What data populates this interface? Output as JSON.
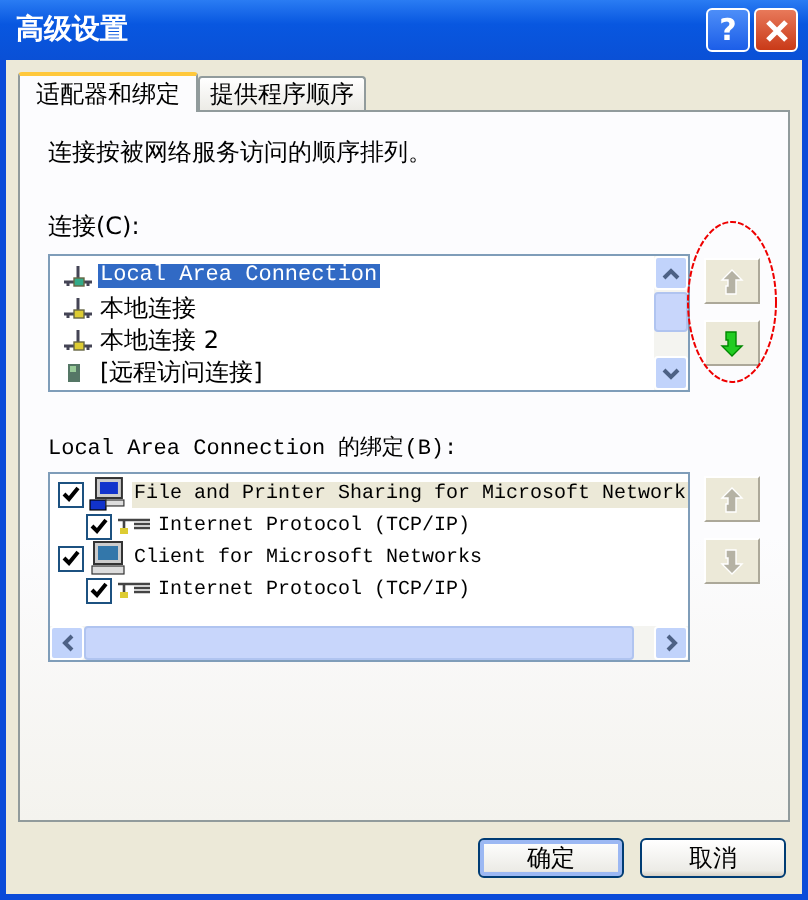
{
  "window": {
    "title": "高级设置",
    "help": "?"
  },
  "tabs": [
    {
      "label": "适配器和绑定",
      "selected": true
    },
    {
      "label": "提供程序顺序",
      "selected": false
    }
  ],
  "description": "连接按被网络服务访问的顺序排列。",
  "connections_label": "连接(C):",
  "connections": [
    {
      "name": "Local Area Connection",
      "kind": "lan",
      "selected": true
    },
    {
      "name": "本地连接",
      "kind": "lan",
      "selected": false
    },
    {
      "name": "本地连接 2",
      "kind": "lan",
      "selected": false
    },
    {
      "name": "[远程访问连接]",
      "kind": "remote",
      "selected": false
    }
  ],
  "connection_buttons": [
    {
      "kind": "up",
      "disabled": true
    },
    {
      "kind": "down",
      "disabled": false
    }
  ],
  "bindings_label": "Local Area Connection 的绑定(B):",
  "bindings": [
    {
      "name": "File and Printer Sharing for Microsoft Network",
      "kind": "service",
      "checked": true,
      "selected": true,
      "children": [
        {
          "name": "Internet Protocol (TCP/IP)",
          "kind": "protocol",
          "checked": true,
          "selected": false
        }
      ]
    },
    {
      "name": "Client for Microsoft Networks",
      "kind": "client",
      "checked": true,
      "selected": false,
      "children": [
        {
          "name": "Internet Protocol (TCP/IP)",
          "kind": "protocol",
          "checked": true,
          "selected": false
        }
      ]
    }
  ],
  "binding_buttons": [
    {
      "kind": "up",
      "disabled": true
    },
    {
      "kind": "down",
      "disabled": true
    }
  ],
  "annotation": {
    "kind": "ellipse"
  },
  "buttons": [
    {
      "label": "确定",
      "default": true
    },
    {
      "label": "取消",
      "default": false
    }
  ]
}
